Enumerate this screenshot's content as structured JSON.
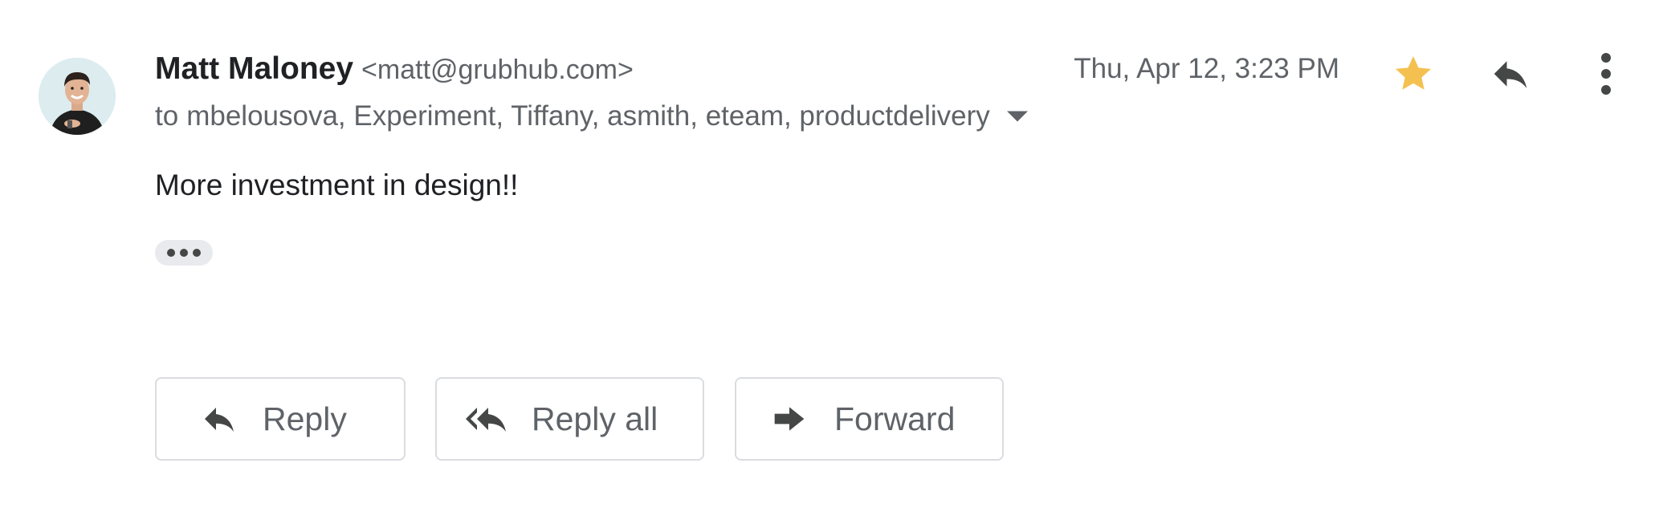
{
  "message": {
    "sender_name": "Matt Maloney",
    "sender_email": "<matt@grubhub.com>",
    "date": "Thu, Apr 12, 3:23 PM",
    "recipients_prefix": "to",
    "recipients": "mbelousova, Experiment, Tiffany, asmith, eteam, productdelivery",
    "body": "More investment in design!!",
    "starred": true
  },
  "icons": {
    "star": "star-icon",
    "reply": "reply-icon",
    "more": "more-vert-icon",
    "caret": "caret-down-icon",
    "reply_all": "reply-all-icon",
    "forward": "forward-icon"
  },
  "actions": {
    "reply_label": "Reply",
    "reply_all_label": "Reply all",
    "forward_label": "Forward"
  },
  "colors": {
    "star": "#F4C150",
    "icon": "#444746",
    "secondary_text": "#5f6368",
    "primary_text": "#202124",
    "button_border": "#dadce0"
  }
}
